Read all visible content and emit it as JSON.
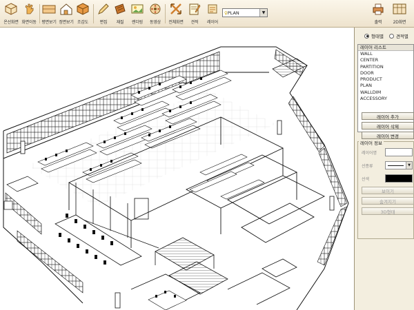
{
  "toolbar": {
    "buttons": [
      {
        "label": "온선화면",
        "icon": "cube-icon"
      },
      {
        "label": "화면이동",
        "icon": "pan-icon"
      },
      {
        "label": "평면보기",
        "icon": "plan-view-icon"
      },
      {
        "label": "정면보기",
        "icon": "front-view-icon"
      },
      {
        "label": "조감도",
        "icon": "birdseye-icon"
      },
      {
        "label": "편집",
        "icon": "edit-icon"
      },
      {
        "label": "재질",
        "icon": "material-icon"
      },
      {
        "label": "렌더링",
        "icon": "render-icon"
      },
      {
        "label": "동영상",
        "icon": "video-icon"
      },
      {
        "label": "전체화면",
        "icon": "fullscreen-icon"
      },
      {
        "label": "견적",
        "icon": "estimate-icon"
      },
      {
        "label": "레이어",
        "icon": "layer-icon"
      }
    ],
    "plan_select": "PLAN",
    "right_buttons": [
      {
        "label": "출력",
        "icon": "print-icon"
      },
      {
        "label": "2D화면",
        "icon": "2d-view-icon"
      }
    ]
  },
  "panel": {
    "radio_options": [
      "형태별",
      "견적별"
    ],
    "radio_selected": "형태별",
    "layer_list_header": "레이어 리스트",
    "layers": [
      "WALL",
      "CENTER",
      "PARTITION",
      "DOOR",
      "PRODUCT",
      "PLAN",
      "WALLDIM",
      "ACCESSORY"
    ],
    "buttons": [
      "레이어 추가",
      "레이어 삭제",
      "레이어 변경"
    ],
    "info_title": "레이어 정보",
    "info_labels": {
      "name": "레이어명",
      "line_type": "선종류",
      "color": "선색"
    },
    "bottom_buttons": [
      "보이기",
      "숨겨지기",
      "3D형태"
    ]
  },
  "colors": {
    "toolbar_bg": "#eee3cd",
    "panel_bg": "#f3eedf"
  }
}
